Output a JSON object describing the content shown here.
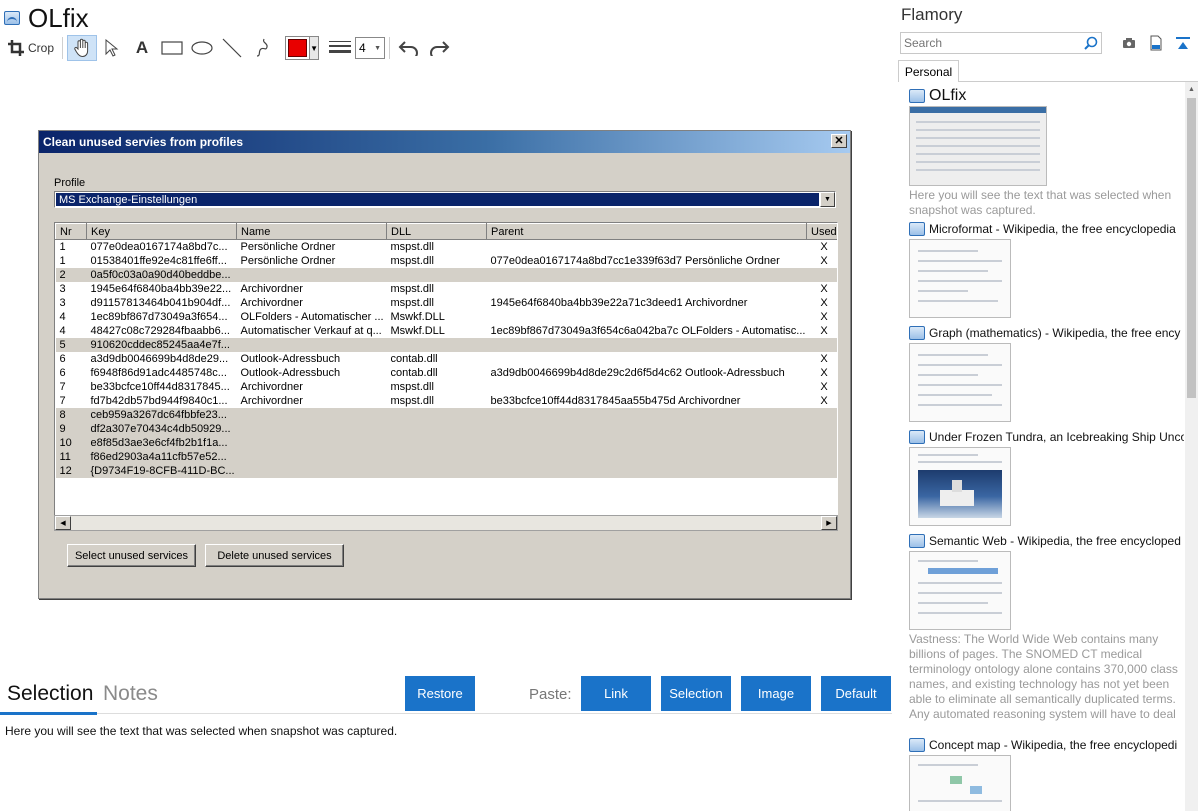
{
  "app_title": "OLfix",
  "toolbar": {
    "crop_label": "Crop",
    "text_tool": "A",
    "line_width": "4"
  },
  "dialog": {
    "title": "Clean unused servies from profiles",
    "profile_label": "Profile",
    "profile_value": "MS Exchange-Einstellungen",
    "columns": [
      "Nr",
      "Key",
      "Name",
      "DLL",
      "Parent",
      "Used"
    ],
    "rows": [
      {
        "nr": "1",
        "key": "077e0dea0167174a8bd7c...",
        "name": "Persönliche Ordner",
        "dll": "mspst.dll",
        "parent": "",
        "used": "X",
        "gray": false
      },
      {
        "nr": "1",
        "key": "01538401ffe92e4c81ffe6ff...",
        "name": "Persönliche Ordner",
        "dll": "mspst.dll",
        "parent": "077e0dea0167174a8bd7cc1e339f63d7 Persönliche Ordner",
        "used": "X",
        "gray": false
      },
      {
        "nr": "2",
        "key": "0a5f0c03a0a90d40beddbe...",
        "name": "",
        "dll": "",
        "parent": "",
        "used": "",
        "gray": true
      },
      {
        "nr": "3",
        "key": "1945e64f6840ba4bb39e22...",
        "name": "Archivordner",
        "dll": "mspst.dll",
        "parent": "",
        "used": "X",
        "gray": false
      },
      {
        "nr": "3",
        "key": "d91157813464b041b904df...",
        "name": "Archivordner",
        "dll": "mspst.dll",
        "parent": "1945e64f6840ba4bb39e22a71c3deed1 Archivordner",
        "used": "X",
        "gray": false
      },
      {
        "nr": "4",
        "key": "1ec89bf867d73049a3f654...",
        "name": "OLFolders - Automatischer ...",
        "dll": "Mswkf.DLL",
        "parent": "",
        "used": "X",
        "gray": false
      },
      {
        "nr": "4",
        "key": "48427c08c729284fbaabb6...",
        "name": "Automatischer Verkauf at q...",
        "dll": "Mswkf.DLL",
        "parent": "1ec89bf867d73049a3f654c6a042ba7c OLFolders - Automatisc...",
        "used": "X",
        "gray": false
      },
      {
        "nr": "5",
        "key": "910620cddec85245aa4e7f...",
        "name": "",
        "dll": "",
        "parent": "",
        "used": "",
        "gray": true
      },
      {
        "nr": "6",
        "key": "a3d9db0046699b4d8de29...",
        "name": "Outlook-Adressbuch",
        "dll": "contab.dll",
        "parent": "",
        "used": "X",
        "gray": false
      },
      {
        "nr": "6",
        "key": "f6948f86d91adc4485748c...",
        "name": "Outlook-Adressbuch",
        "dll": "contab.dll",
        "parent": "a3d9db0046699b4d8de29c2d6f5d4c62 Outlook-Adressbuch",
        "used": "X",
        "gray": false
      },
      {
        "nr": "7",
        "key": "be33bcfce10ff44d8317845...",
        "name": "Archivordner",
        "dll": "mspst.dll",
        "parent": "",
        "used": "X",
        "gray": false
      },
      {
        "nr": "7",
        "key": "fd7b42db57bd944f9840c1...",
        "name": "Archivordner",
        "dll": "mspst.dll",
        "parent": "be33bcfce10ff44d8317845aa55b475d Archivordner",
        "used": "X",
        "gray": false
      },
      {
        "nr": "8",
        "key": "ceb959a3267dc64fbbfe23...",
        "name": "",
        "dll": "",
        "parent": "",
        "used": "",
        "gray": true
      },
      {
        "nr": "9",
        "key": "df2a307e70434c4db50929...",
        "name": "",
        "dll": "",
        "parent": "",
        "used": "",
        "gray": true
      },
      {
        "nr": "10",
        "key": "e8f85d3ae3e6cf4fb2b1f1a...",
        "name": "",
        "dll": "",
        "parent": "",
        "used": "",
        "gray": true
      },
      {
        "nr": "11",
        "key": "f86ed2903a4a11cfb57e52...",
        "name": "",
        "dll": "",
        "parent": "",
        "used": "",
        "gray": true
      },
      {
        "nr": "12",
        "key": "{D9734F19-8CFB-411D-BC...",
        "name": "",
        "dll": "",
        "parent": "",
        "used": "",
        "gray": true
      }
    ],
    "select_button": "Select unused services",
    "delete_button": "Delete unused services"
  },
  "bottom": {
    "tab_selection": "Selection",
    "tab_notes": "Notes",
    "restore_label": "Restore",
    "paste_label": "Paste:",
    "link_label": "Link",
    "selection_label": "Selection",
    "image_label": "Image",
    "default_label": "Default",
    "selection_text": "Here you will see the text that was selected when snapshot was captured."
  },
  "sidebar": {
    "app_name": "Flamory",
    "search_placeholder": "Search",
    "tab_personal": "Personal",
    "entries": [
      {
        "title": "OLfix",
        "desc": "Here you will see the text that was selected when snapshot was captured."
      },
      {
        "title": "Microformat - Wikipedia, the free encyclopedia",
        "desc": ""
      },
      {
        "title": "Graph (mathematics) - Wikipedia, the free ency",
        "desc": ""
      },
      {
        "title": "Under Frozen Tundra, an Icebreaking Ship Unco",
        "desc": ""
      },
      {
        "title": "Semantic Web - Wikipedia, the free encycloped",
        "desc": "Vastness: The World Wide Web contains many billions of pages. The SNOMED CT medical terminology ontology alone contains 370,000 class names, and existing technology has not yet been able to eliminate all semantically duplicated terms. Any automated reasoning system will have to deal with truly huge inputs."
      },
      {
        "title": "Concept map - Wikipedia, the free encyclopedi",
        "desc": ""
      }
    ]
  },
  "colors": {
    "accent": "#1a73c9",
    "pen": "#e80000",
    "dialog_bg": "#d4d0c8",
    "titlebar": "#0a246a"
  }
}
